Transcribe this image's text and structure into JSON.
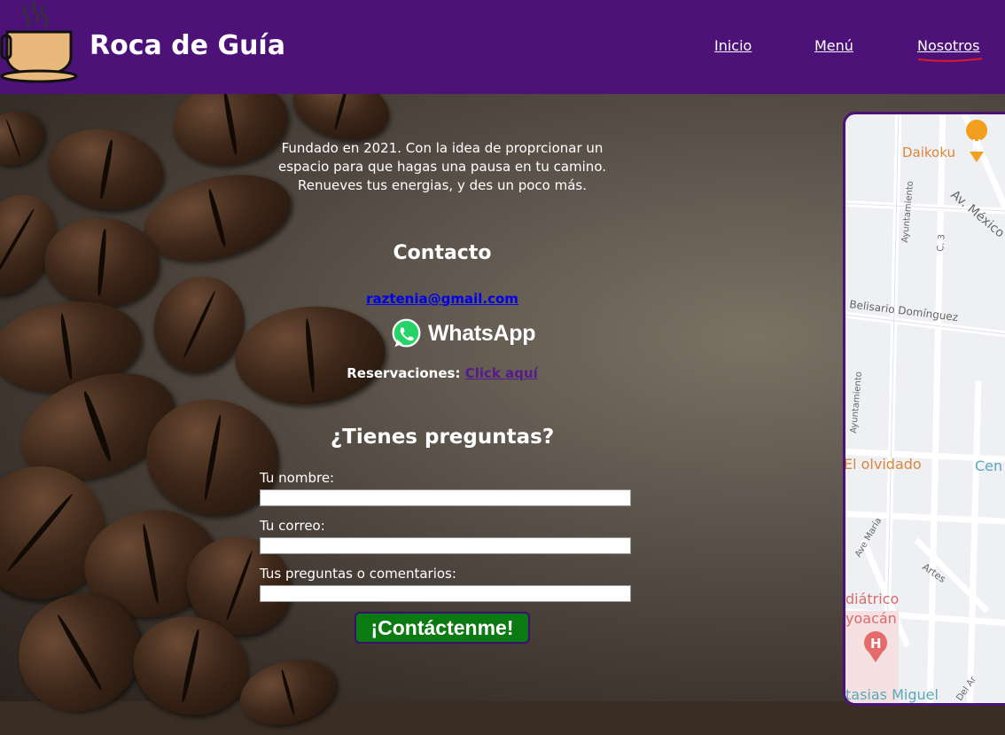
{
  "header": {
    "brand": "Roca de Guía",
    "nav": [
      {
        "label": "Inicio"
      },
      {
        "label": "Menú"
      },
      {
        "label": "Nosotros"
      }
    ]
  },
  "about": {
    "text": "Fundado en 2021. Con la idea de proprcionar un espacio para que hagas una pausa en tu camino. Renueves tus energias, y des un poco más."
  },
  "contact": {
    "title": "Contacto",
    "email": "raztenia@gmail.com",
    "whatsapp_label": "WhatsApp",
    "reservations_label": "Reservaciones:",
    "reservations_link": "Click aquí"
  },
  "form": {
    "title": "¿Tienes preguntas?",
    "name_label": "Tu nombre:",
    "email_label": "Tu correo:",
    "comments_label": "Tus preguntas o comentarios:",
    "name_value": "",
    "email_value": "",
    "comments_value": "",
    "submit_label": "¡Contáctenme!"
  },
  "map": {
    "labels": [
      "Daikoku",
      "Av. México",
      "Ayuntamiento",
      "C. 3",
      "Belisario Domínguez",
      "Ayuntamiento",
      "El olvidado",
      "Cen",
      "Ave María",
      "Artes",
      "diátrico",
      "yoacán",
      "tasias Miguel",
      "Del Ar"
    ]
  },
  "colors": {
    "header_bg": "#4d1278",
    "submit_bg": "#0b7a12",
    "email_link": "#0000ee",
    "visited_link": "#551a8b",
    "whatsapp_green": "#25d366"
  }
}
